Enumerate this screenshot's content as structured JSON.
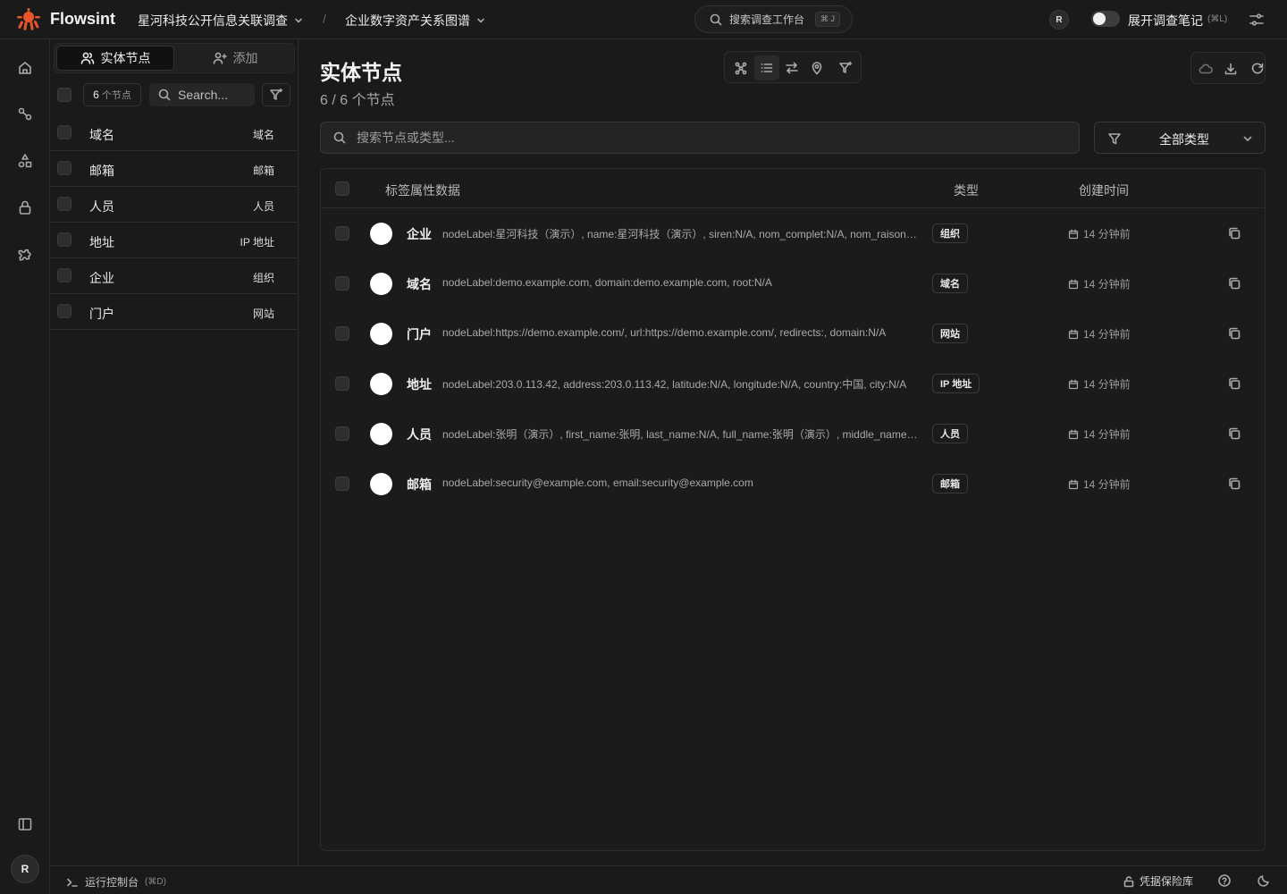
{
  "app": {
    "brand": "Flowsint",
    "investigation": "星河科技公开信息关联调查",
    "sketch": "企业数字资产关系图谱",
    "search_label": "搜索调查工作台",
    "search_kbd": "⌘ J",
    "user_initial": "R",
    "notes_label": "展开调查笔记",
    "notes_kbd": "(⌘L)",
    "accent_color": "#e8562a"
  },
  "left_panel": {
    "tabs": [
      {
        "label": "实体节点",
        "icon": "users-icon",
        "active": true
      },
      {
        "label": "添加",
        "icon": "user-plus-icon",
        "active": false
      }
    ],
    "count": "6",
    "count_unit": "个节点",
    "search_placeholder": "Search...",
    "items": [
      {
        "label": "域名",
        "type": "域名"
      },
      {
        "label": "邮箱",
        "type": "邮箱"
      },
      {
        "label": "人员",
        "type": "人员"
      },
      {
        "label": "地址",
        "type": "IP 地址"
      },
      {
        "label": "企业",
        "type": "组织"
      },
      {
        "label": "门户",
        "type": "网站"
      }
    ]
  },
  "main": {
    "title": "实体节点",
    "subtitle": "6 / 6 个节点",
    "search_placeholder": "搜索节点或类型...",
    "type_filter": "全部类型",
    "columns": {
      "props": "标签属性数据",
      "type": "类型",
      "created": "创建时间"
    },
    "rows": [
      {
        "name": "企业",
        "props": "nodeLabel:星河科技（演示）, name:星河科技（演示）, siren:N/A, nom_complet:N/A, nom_raison_sociale:N/A",
        "type": "组织",
        "created": "14 分钟前"
      },
      {
        "name": "域名",
        "props": "nodeLabel:demo.example.com, domain:demo.example.com, root:N/A",
        "type": "域名",
        "created": "14 分钟前"
      },
      {
        "name": "门户",
        "props": "nodeLabel:https://demo.example.com/, url:https://demo.example.com/, redirects:, domain:N/A",
        "type": "网站",
        "created": "14 分钟前"
      },
      {
        "name": "地址",
        "props": "nodeLabel:203.0.113.42, address:203.0.113.42, latitude:N/A, longitude:N/A, country:中国, city:N/A",
        "type": "IP 地址",
        "created": "14 分钟前"
      },
      {
        "name": "人员",
        "props": "nodeLabel:张明（演示）, first_name:张明, last_name:N/A, full_name:张明（演示）, middle_name:N/A",
        "type": "人员",
        "created": "14 分钟前"
      },
      {
        "name": "邮箱",
        "props": "nodeLabel:security@example.com, email:security@example.com",
        "type": "邮箱",
        "created": "14 分钟前"
      }
    ]
  },
  "bottom": {
    "console_label": "运行控制台",
    "console_kbd": "(⌘D)",
    "vault_label": "凭据保险库"
  }
}
